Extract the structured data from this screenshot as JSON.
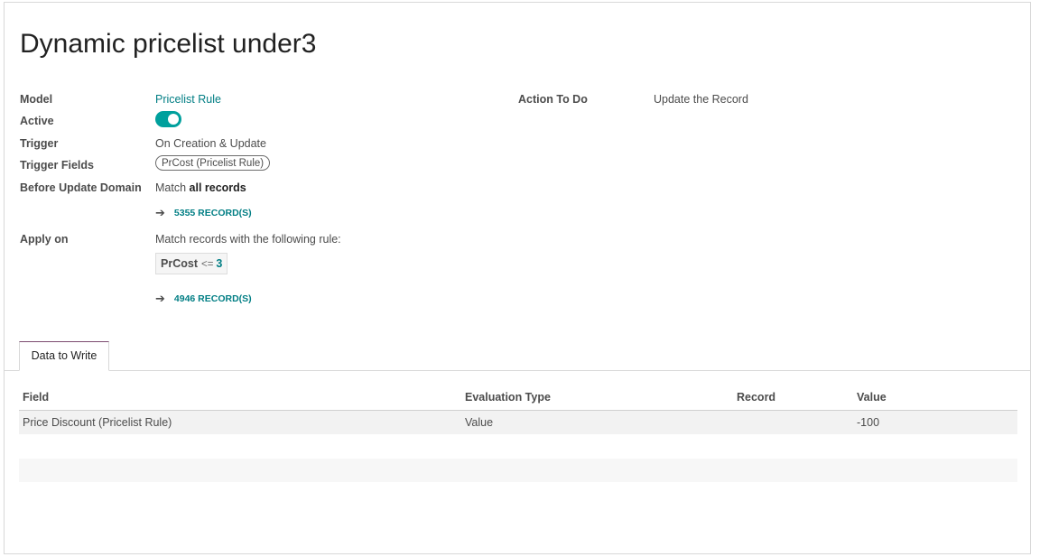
{
  "title": "Dynamic pricelist under3",
  "fields": {
    "model_label": "Model",
    "model_value": "Pricelist Rule",
    "active_label": "Active",
    "active_value": true,
    "trigger_label": "Trigger",
    "trigger_value": "On Creation & Update",
    "trigger_fields_label": "Trigger Fields",
    "trigger_fields_tag": "PrCost (Pricelist Rule)",
    "before_domain_label": "Before Update Domain",
    "before_domain_prefix": "Match ",
    "before_domain_bold": "all records",
    "before_domain_records": "5355 RECORD(S)",
    "apply_on_label": "Apply on",
    "apply_on_value": "Match records with the following rule:",
    "rule_field": "PrCost",
    "rule_operator": "<=",
    "rule_value": "3",
    "apply_on_records": "4946 RECORD(S)",
    "action_label": "Action To Do",
    "action_value": "Update the Record"
  },
  "tabs": [
    {
      "label": "Data to Write",
      "active": true
    }
  ],
  "table": {
    "columns": [
      "Field",
      "Evaluation Type",
      "Record",
      "Value"
    ],
    "rows": [
      {
        "field": "Price Discount (Pricelist Rule)",
        "evaluation_type": "Value",
        "record": "",
        "value": "-100"
      }
    ]
  },
  "colors": {
    "accent": "#017e84",
    "toggle_on": "#00a09d",
    "tab_top_border": "#7c4a6f"
  }
}
